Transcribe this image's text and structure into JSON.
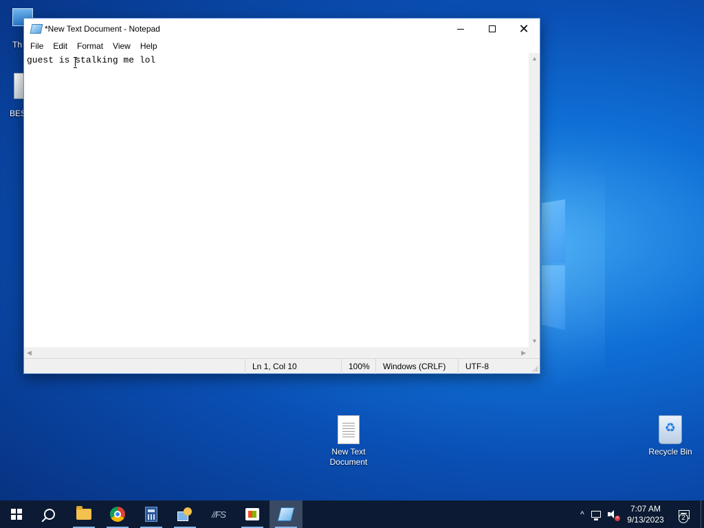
{
  "desktop": {
    "icons": [
      {
        "label": "Th",
        "name": "this-pc-shortcut"
      },
      {
        "label": "BES",
        "name": "partial-shortcut"
      },
      {
        "label": "New Text Document",
        "name": "new-text-document"
      },
      {
        "label": "Recycle Bin",
        "name": "recycle-bin"
      }
    ]
  },
  "notepad": {
    "title": "*New Text Document - Notepad",
    "menu": [
      "File",
      "Edit",
      "Format",
      "View",
      "Help"
    ],
    "content": "guest is stalking me lol",
    "status": {
      "position": "Ln 1, Col 10",
      "zoom": "100%",
      "line_ending": "Windows (CRLF)",
      "encoding": "UTF-8"
    }
  },
  "taskbar": {
    "pinned": [
      {
        "name": "start",
        "icon": "windows-logo-icon"
      },
      {
        "name": "search",
        "icon": "search-icon"
      },
      {
        "name": "file-explorer",
        "icon": "folder-icon"
      },
      {
        "name": "chrome",
        "icon": "chrome-icon"
      },
      {
        "name": "calculator",
        "icon": "calculator-icon"
      },
      {
        "name": "tool",
        "icon": "tool-icon"
      },
      {
        "name": "text-app",
        "icon": "text-app-icon",
        "glyph": "//FS"
      },
      {
        "name": "store",
        "icon": "store-icon"
      },
      {
        "name": "notepad",
        "icon": "notepad-icon"
      }
    ],
    "tray": {
      "chevron": "^",
      "time": "7:07 AM",
      "date": "9/13/2023",
      "notification_count": "2"
    }
  },
  "colors": {
    "taskbar_bg": "#0c1b33",
    "window_border": "#5a8fd8",
    "status_bg": "#f0f0f0"
  }
}
